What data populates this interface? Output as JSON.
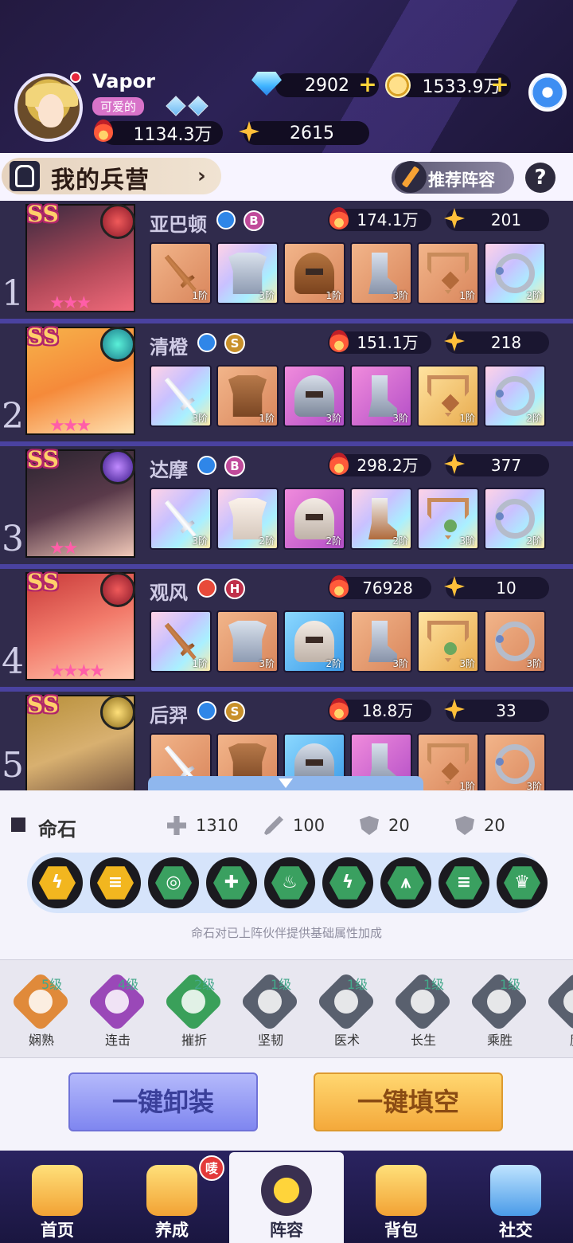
{
  "player": {
    "name": "Vapor",
    "tag": "可爱的",
    "diamonds": "2902",
    "gold": "1533.9万",
    "power": "1134.3万",
    "stars": "2615"
  },
  "barracks": {
    "title": "我的兵营",
    "recommend_label": "推荐阵容",
    "help": "?"
  },
  "heroes": [
    {
      "index": "1",
      "rank": "SS",
      "name": "亚巴顿",
      "grade": "B",
      "power": "174.1万",
      "level": "201",
      "equip_tiers": [
        "1阶",
        "3阶",
        "1阶",
        "3阶",
        "1阶",
        "2阶"
      ]
    },
    {
      "index": "2",
      "rank": "SS",
      "name": "清橙",
      "grade": "S",
      "power": "151.1万",
      "level": "218",
      "equip_tiers": [
        "3阶",
        "1阶",
        "3阶",
        "3阶",
        "1阶",
        "2阶"
      ]
    },
    {
      "index": "3",
      "rank": "SS",
      "name": "达摩",
      "grade": "B",
      "power": "298.2万",
      "level": "377",
      "equip_tiers": [
        "3阶",
        "2阶",
        "2阶",
        "2阶",
        "3阶",
        "2阶"
      ]
    },
    {
      "index": "4",
      "rank": "SS",
      "name": "观风",
      "grade": "H",
      "power": "76928",
      "level": "10",
      "equip_tiers": [
        "1阶",
        "3阶",
        "2阶",
        "3阶",
        "3阶",
        "3阶"
      ]
    },
    {
      "index": "5",
      "rank": "SS",
      "name": "后羿",
      "grade": "S",
      "power": "18.8万",
      "level": "33",
      "equip_tiers": [
        "",
        "",
        "",
        "",
        "1阶",
        "3阶"
      ]
    }
  ],
  "fate_stone": {
    "title": "命石",
    "stats": {
      "hp": "1310",
      "atk": "100",
      "def": "20",
      "res": "20"
    },
    "note": "命石对已上阵伙伴提供基础属性加成"
  },
  "skills": [
    {
      "name": "娴熟",
      "level": "5级",
      "color": "#e08a3a"
    },
    {
      "name": "连击",
      "level": "4级",
      "color": "#9a48b8"
    },
    {
      "name": "摧折",
      "level": "2级",
      "color": "#3aa05a"
    },
    {
      "name": "坚韧",
      "level": "1级",
      "color": "#59606e"
    },
    {
      "name": "医术",
      "level": "1级",
      "color": "#59606e"
    },
    {
      "name": "长生",
      "level": "1级",
      "color": "#59606e"
    },
    {
      "name": "乘胜",
      "level": "1级",
      "color": "#59606e"
    },
    {
      "name": "魔",
      "level": "",
      "color": "#59606e"
    }
  ],
  "actions": {
    "unequip_all": "一键卸装",
    "fill_all": "一键填空"
  },
  "nav": [
    {
      "label": "首页"
    },
    {
      "label": "养成",
      "badge": "唛"
    },
    {
      "label": "阵容"
    },
    {
      "label": "背包"
    },
    {
      "label": "社交"
    }
  ]
}
